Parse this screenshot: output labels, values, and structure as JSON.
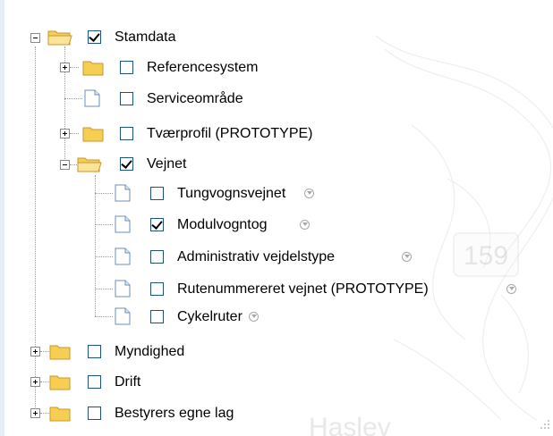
{
  "tree": {
    "root": {
      "label": "Stamdata",
      "checked": true,
      "expanded": true
    },
    "root_children": [
      {
        "label": "Referencesystem",
        "checked": false,
        "expandable": true
      },
      {
        "label": "Serviceområde",
        "checked": false,
        "expandable": false
      },
      {
        "label": "Tværprofil (PROTOTYPE)",
        "checked": false,
        "expandable": true
      },
      {
        "label": "Vejnet",
        "checked": true,
        "expanded": true
      }
    ],
    "vejnet_children": [
      {
        "label": "Tungvognsvejnet",
        "checked": false
      },
      {
        "label": "Modulvogntog",
        "checked": true
      },
      {
        "label": "Administrativ vejdelstype",
        "checked": false
      },
      {
        "label": "Rutenummereret vejnet (PROTOTYPE)",
        "checked": false
      },
      {
        "label": "Cykelruter",
        "checked": false
      }
    ],
    "top_level": [
      {
        "label": "Myndighed",
        "checked": false
      },
      {
        "label": "Drift",
        "checked": false
      },
      {
        "label": "Bestyrers egne lag",
        "checked": false
      }
    ]
  },
  "map": {
    "road_number": "159",
    "place_text": "Haslev"
  },
  "colors": {
    "folder": "#f6cf52",
    "folder_edge": "#c9962a",
    "checkbox_border": "#1c5180"
  },
  "icons": {
    "folder": "folder-icon",
    "folder_open": "folder-open-icon",
    "leaf": "document-icon",
    "info": "info-chevron-icon"
  }
}
